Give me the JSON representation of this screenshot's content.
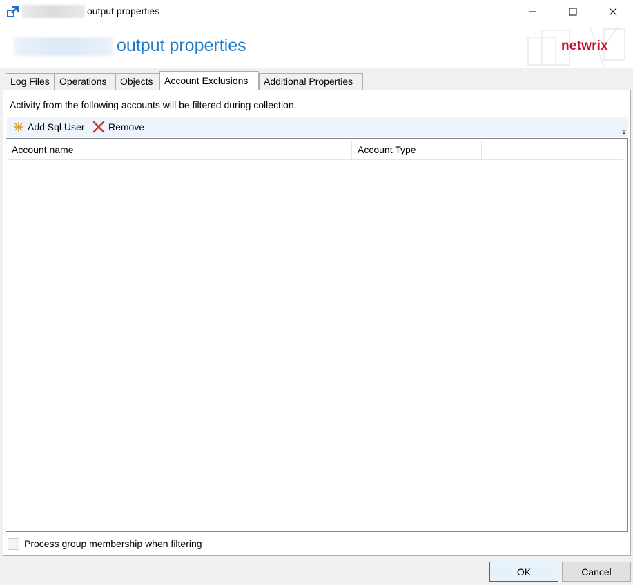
{
  "window": {
    "title": "output properties"
  },
  "header": {
    "title": "output properties",
    "brand": "netwrix",
    "brand_color": "#c8102e",
    "accent_color": "#1e7bc9"
  },
  "tabs": [
    {
      "label": "Log Files",
      "active": false
    },
    {
      "label": "Operations",
      "active": false
    },
    {
      "label": "Objects",
      "active": false
    },
    {
      "label": "Account Exclusions",
      "active": true
    },
    {
      "label": "Additional Properties",
      "active": false
    }
  ],
  "panel": {
    "description": "Activity from the following accounts will be filtered during collection.",
    "toolbar": {
      "add_label": "Add Sql User",
      "add_icon": "sparkle-icon",
      "remove_label": "Remove",
      "remove_icon": "red-x-icon"
    },
    "table": {
      "columns": [
        "Account name",
        "Account Type"
      ],
      "rows": []
    },
    "checkbox": {
      "label": "Process group membership when filtering",
      "checked": false
    }
  },
  "buttons": {
    "ok": "OK",
    "cancel": "Cancel"
  }
}
